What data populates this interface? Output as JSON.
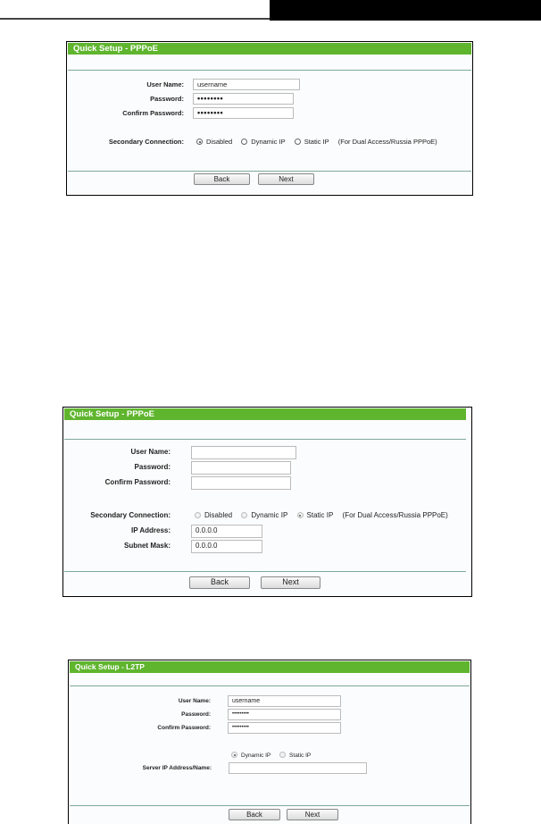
{
  "panels": [
    {
      "title": "Quick Setup - PPPoE",
      "fields": [
        {
          "label": "User Name:",
          "value": "username"
        },
        {
          "label": "Password:",
          "value": "••••••••"
        },
        {
          "label": "Confirm Password:",
          "value": "••••••••"
        }
      ],
      "secondary": {
        "label": "Secondary Connection:",
        "options": [
          {
            "label": "Disabled",
            "checked": true
          },
          {
            "label": "Dynamic IP",
            "checked": false
          },
          {
            "label": "Static IP",
            "checked": false
          }
        ],
        "note": "(For Dual Access/Russia PPPoE)"
      },
      "buttons": {
        "back": "Back",
        "next": "Next"
      }
    },
    {
      "title": "Quick Setup - PPPoE",
      "fields": [
        {
          "label": "User Name:",
          "value": ""
        },
        {
          "label": "Password:",
          "value": ""
        },
        {
          "label": "Confirm Password:",
          "value": ""
        }
      ],
      "secondary": {
        "label": "Secondary Connection:",
        "options": [
          {
            "label": "Disabled",
            "checked": false
          },
          {
            "label": "Dynamic IP",
            "checked": false
          },
          {
            "label": "Static IP",
            "checked": true
          }
        ],
        "note": "(For Dual Access/Russia PPPoE)"
      },
      "static_fields": [
        {
          "label": "IP Address:",
          "value": "0.0.0.0"
        },
        {
          "label": "Subnet Mask:",
          "value": "0.0.0.0"
        }
      ],
      "buttons": {
        "back": "Back",
        "next": "Next"
      }
    },
    {
      "title": "Quick Setup - L2TP",
      "fields": [
        {
          "label": "User Name:",
          "value": "username"
        },
        {
          "label": "Password:",
          "value": "•••••••••"
        },
        {
          "label": "Confirm Password:",
          "value": "•••••••••"
        }
      ],
      "ip_mode": {
        "options": [
          {
            "label": "Dynamic IP",
            "checked": true
          },
          {
            "label": "Static IP",
            "checked": false
          }
        ]
      },
      "server": {
        "label": "Server IP Address/Name:",
        "value": ""
      },
      "buttons": {
        "back": "Back",
        "next": "Next"
      }
    }
  ],
  "colors": {
    "header_green": "#5fb52e",
    "separator": "#7fa99a"
  }
}
